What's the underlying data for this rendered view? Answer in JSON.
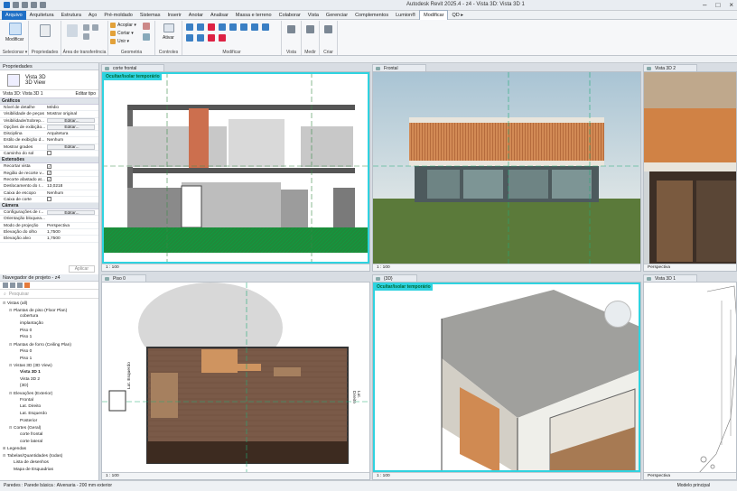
{
  "app": {
    "title": "Autodesk Revit 2025.4 - z4 - Vista 3D: Vista 3D 1"
  },
  "ribbon_tabs": [
    "Arquivo",
    "Arquitetura",
    "Estrutura",
    "Aço",
    "Pré-moldado",
    "Sistemas",
    "Inserir",
    "Anotar",
    "Analisar",
    "Massa e terreno",
    "Colaborar",
    "Vista",
    "Gerenciar",
    "Complementos",
    "Lumion®",
    "Modificar",
    "QD ▸"
  ],
  "active_tab": "Modificar",
  "ribbon": {
    "groups": [
      "Selecionar ▾",
      "Propriedades",
      "Área de transferência",
      "Geometria",
      "Controles",
      "Modificar",
      "Vista",
      "Medir",
      "Criar"
    ],
    "modify_label": "Modificar",
    "cut_label": "Cortar ▾",
    "join_label": "Unir ▾",
    "cope_label": "Acoplar ▾",
    "activate_label": "Ativar"
  },
  "properties": {
    "title": "Propriedades",
    "type_name": "Vista 3D",
    "type_sub": "3D View",
    "selector": "Vista 3D: Vista 3D 1",
    "edit_type": "Editar tipo",
    "apply": "Aplicar",
    "rows": [
      {
        "cat": "Gráficos"
      },
      {
        "k": "Nível de detalhe",
        "v": "Médio"
      },
      {
        "k": "Visibilidade de peças",
        "v": "Mostrar original"
      },
      {
        "k": "Visibilidade/Sobrep...",
        "v": "Editar...",
        "btn": true
      },
      {
        "k": "Opções de exibição...",
        "v": "Editar...",
        "btn": true
      },
      {
        "k": "Disciplina",
        "v": "Arquitetura"
      },
      {
        "k": "Estilo de exibição d...",
        "v": "Nenhum"
      },
      {
        "k": "Mostrar grades",
        "v": "Editar...",
        "btn": true
      },
      {
        "k": "Caminho do sol",
        "v": "",
        "chk": true,
        "checked": false
      },
      {
        "cat": "Extensões"
      },
      {
        "k": "Recortar vista",
        "v": "",
        "chk": true,
        "checked": true
      },
      {
        "k": "Região de recorte v...",
        "v": "",
        "chk": true,
        "checked": true
      },
      {
        "k": "Recorte afastado at...",
        "v": "",
        "chk": true,
        "checked": true
      },
      {
        "k": "Deslocamento do r...",
        "v": "13,0218"
      },
      {
        "k": "Caixa de escopo",
        "v": "Nenhum"
      },
      {
        "k": "Caixa de corte",
        "v": "",
        "chk": true,
        "checked": false
      },
      {
        "cat": "Câmera"
      },
      {
        "k": "Configurações de r...",
        "v": "Editar...",
        "btn": true
      },
      {
        "k": "Orientação bloquea...",
        "v": ""
      },
      {
        "k": "Modo de projeção",
        "v": "Perspectiva"
      },
      {
        "k": "Elevação do olho",
        "v": "1,7500"
      },
      {
        "k": "Elevação alvo",
        "v": "1,7500"
      }
    ]
  },
  "browser": {
    "title": "Navegador de projeto - z4",
    "search_placeholder": "Pesquisar",
    "items": [
      {
        "lvl": 0,
        "tg": "⊟",
        "t": "Vistas (all)"
      },
      {
        "lvl": 1,
        "tg": "⊟",
        "t": "Plantas de piso (Floor Plan)"
      },
      {
        "lvl": 2,
        "tg": "",
        "t": "cobertura"
      },
      {
        "lvl": 2,
        "tg": "",
        "t": "implantação"
      },
      {
        "lvl": 2,
        "tg": "",
        "t": "Piso 0"
      },
      {
        "lvl": 2,
        "tg": "",
        "t": "Piso 1"
      },
      {
        "lvl": 1,
        "tg": "⊟",
        "t": "Plantas de forro (Ceiling Plan)"
      },
      {
        "lvl": 2,
        "tg": "",
        "t": "Piso 0"
      },
      {
        "lvl": 2,
        "tg": "",
        "t": "Piso 1"
      },
      {
        "lvl": 1,
        "tg": "⊟",
        "t": "Vistas 3D (3D View)"
      },
      {
        "lvl": 2,
        "tg": "",
        "t": "Vista 3D 1",
        "bold": true
      },
      {
        "lvl": 2,
        "tg": "",
        "t": "Vista 3D 2"
      },
      {
        "lvl": 2,
        "tg": "",
        "t": "{3D}"
      },
      {
        "lvl": 1,
        "tg": "⊟",
        "t": "Elevações (Exterior)"
      },
      {
        "lvl": 2,
        "tg": "",
        "t": "Frontal"
      },
      {
        "lvl": 2,
        "tg": "",
        "t": "Lat. Direito"
      },
      {
        "lvl": 2,
        "tg": "",
        "t": "Lat. Esquerdo"
      },
      {
        "lvl": 2,
        "tg": "",
        "t": "Posterior"
      },
      {
        "lvl": 1,
        "tg": "⊟",
        "t": "Cortes (Geral)"
      },
      {
        "lvl": 2,
        "tg": "",
        "t": "corte frontal"
      },
      {
        "lvl": 2,
        "tg": "",
        "t": "corte lateral"
      },
      {
        "lvl": 0,
        "tg": "⊞",
        "t": "Legendas"
      },
      {
        "lvl": 0,
        "tg": "⊟",
        "t": "Tabelas/Quantidades (todas)"
      },
      {
        "lvl": 1,
        "tg": "",
        "t": "Lista de desenhos"
      },
      {
        "lvl": 1,
        "tg": "",
        "t": "Mapa de Esquadrias"
      }
    ]
  },
  "viewports": {
    "corte": {
      "tab": "corte frontal",
      "highlight": "Ocultar/isolar temporário",
      "scale": "1 : 100"
    },
    "frontal": {
      "tab": "Frontal",
      "scale": "1 : 100"
    },
    "vista2": {
      "tab": "Vista 3D 2",
      "scale": "Perspectiva"
    },
    "piso0": {
      "tab": "Piso 0",
      "scale": "1 : 100",
      "left_label": "Lat. Esquerdo",
      "right_label": "Lat. Direito"
    },
    "vista3d": {
      "tab": "{3D}",
      "highlight": "Ocultar/isolar temporário",
      "scale": "1 : 100"
    },
    "vista1": {
      "tab": "Vista 3D 1",
      "scale": "Perspectiva"
    }
  },
  "status": {
    "text": "Paredes : Parede básica : Alvenaria - 200 mm exterior",
    "model": "Modelo principal"
  }
}
